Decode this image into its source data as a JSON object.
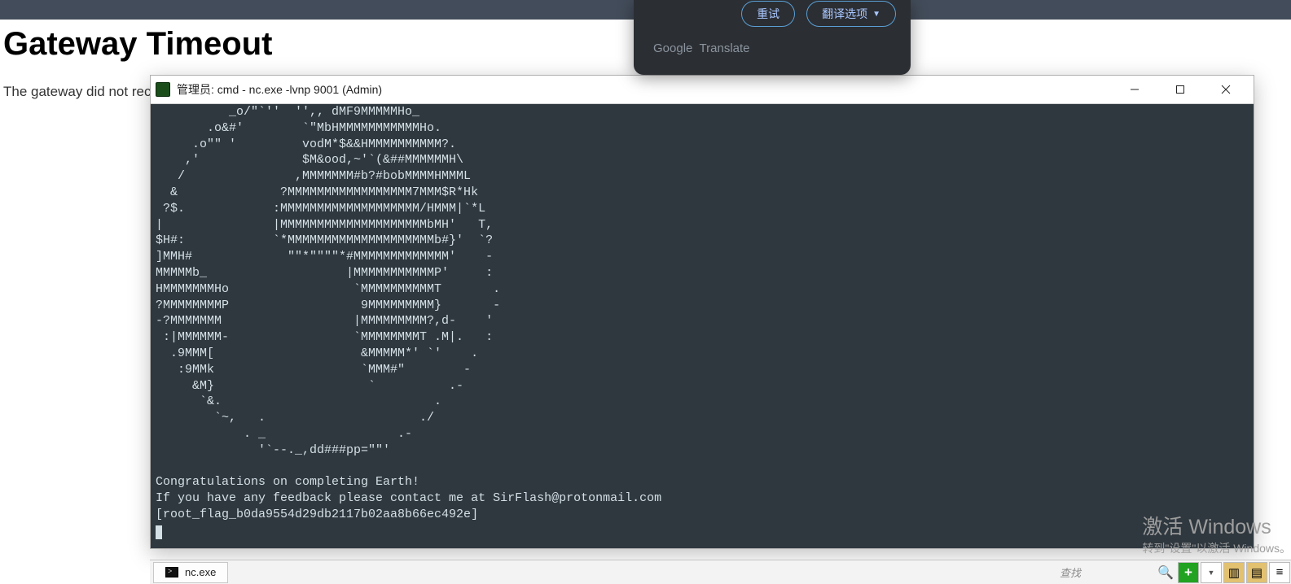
{
  "browser_page": {
    "title": "Gateway Timeout",
    "subtitle": "The gateway did not receive a timely response from the upstream server or application."
  },
  "translate_popup": {
    "retry_label": "重试",
    "options_label": "翻译选项",
    "branding_text": "Google Translate"
  },
  "terminal": {
    "title": "管理员: cmd - nc.exe  -lvnp 9001 (Admin)",
    "output": "          _o/\"`''  '',, dMF9MMMMMHo_\n       .o&#'        `\"MbHMMMMMMMMMMMHo.\n     .o\"\" '         vodM*$&&HMMMMMMMMMM?.\n    ,'              $M&ood,~'`(&##MMMMMMH\\\n   /               ,MMMMMMM#b?#bobMMMMHMMML\n  &              ?MMMMMMMMMMMMMMMMM7MMM$R*Hk\n ?$.            :MMMMMMMMMMMMMMMMMMM/HMMM|`*L\n|               |MMMMMMMMMMMMMMMMMMMMbMH'   T,\n$H#:            `*MMMMMMMMMMMMMMMMMMMMb#}'  `?\n]MMH#             \"\"*\"\"\"\"*#MMMMMMMMMMMMM'    -\nMMMMMb_                   |MMMMMMMMMMMP'     :\nHMMMMMMMHo                 `MMMMMMMMMMT       .\n?MMMMMMMMP                  9MMMMMMMMM}       -\n-?MMMMMMM                  |MMMMMMMMM?,d-    '\n :|MMMMMM-                 `MMMMMMMMT .M|.   :\n  .9MMM[                    &MMMMM*' `'    .\n   :9MMk                    `MMM#\"        -\n     &M}                     `          .-\n      `&.                             .\n        `~,   .                     ./\n            . _                  .-\n              '`--._,dd###pp=\"\"'\n\nCongratulations on completing Earth!\nIf you have any feedback please contact me at SirFlash@protonmail.com\n[root_flag_b0da9554d29db2117b02aa8b66ec492e]"
  },
  "taskbar": {
    "tab_label": "nc.exe",
    "search_placeholder": "查找"
  },
  "watermark": {
    "line1": "激活 Windows",
    "line2": "转到\"设置\"以激活 Windows。"
  }
}
